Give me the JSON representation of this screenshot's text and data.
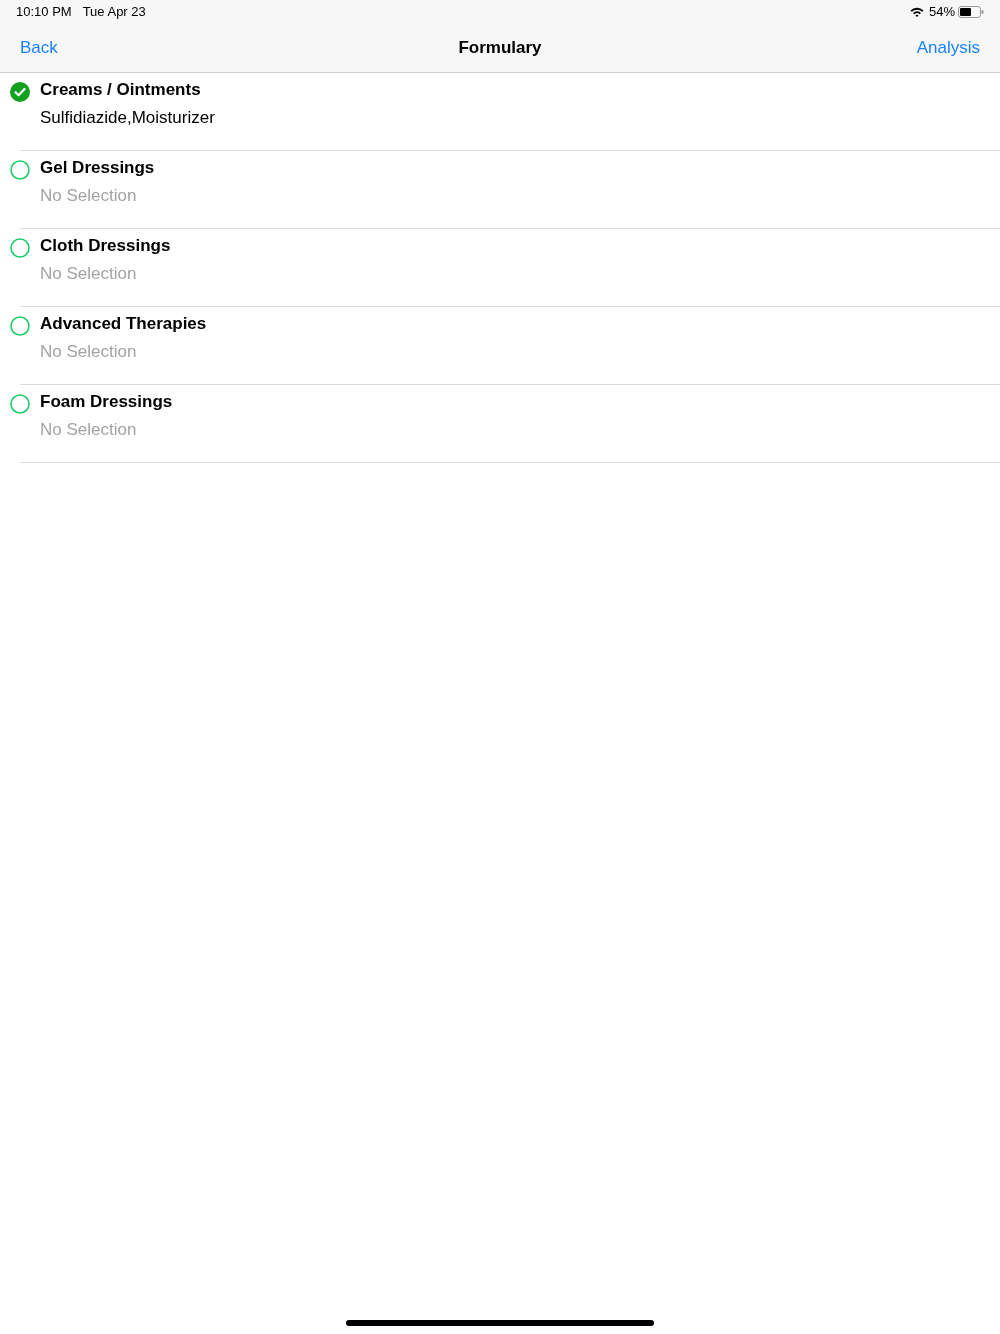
{
  "status_bar": {
    "time": "10:10 PM",
    "date": "Tue Apr 23",
    "battery": "54%"
  },
  "nav_bar": {
    "back": "Back",
    "title": "Formulary",
    "action": "Analysis"
  },
  "items": [
    {
      "title": "Creams / Ointments",
      "subtitle": "Sulfidiazide,Moisturizer",
      "checked": true
    },
    {
      "title": "Gel Dressings",
      "subtitle": "No Selection",
      "checked": false
    },
    {
      "title": "Cloth Dressings",
      "subtitle": "No Selection",
      "checked": false
    },
    {
      "title": "Advanced Therapies",
      "subtitle": "No Selection",
      "checked": false
    },
    {
      "title": "Foam Dressings",
      "subtitle": "No Selection",
      "checked": false
    }
  ]
}
